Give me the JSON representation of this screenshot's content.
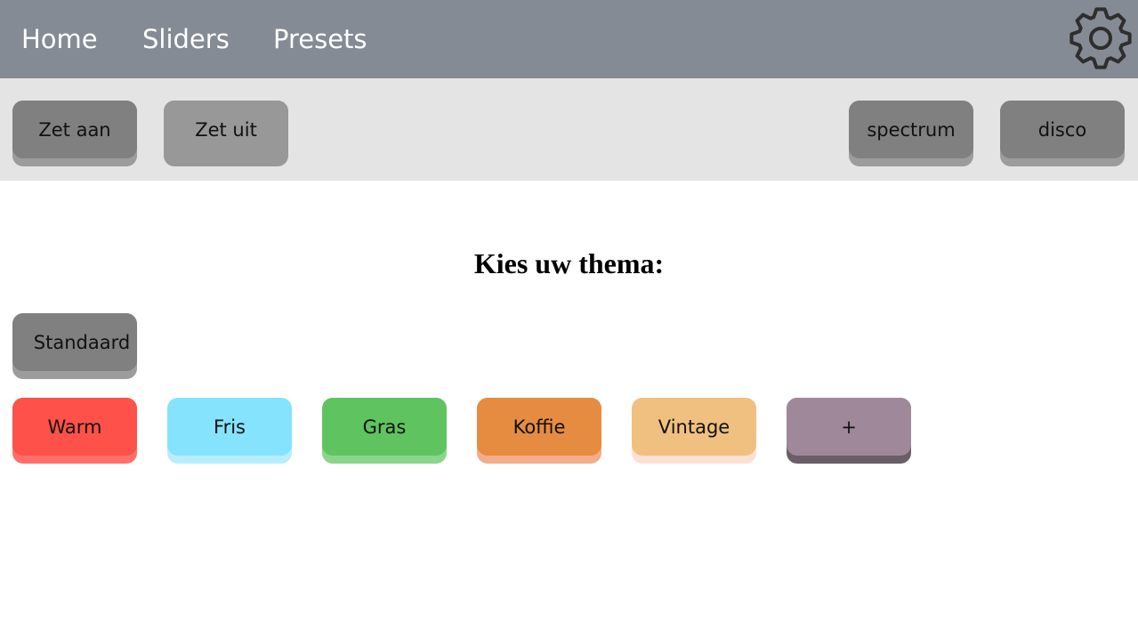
{
  "nav": {
    "links": [
      "Home",
      "Sliders",
      "Presets"
    ]
  },
  "toolbar": {
    "buttons": [
      {
        "label": "Zet aan",
        "face": "#808080",
        "shadow": "#9c9c9c"
      },
      {
        "label": "Zet uit",
        "face": "#989898",
        "shadow": "#989898"
      },
      {
        "label": "spectrum",
        "face": "#808080",
        "shadow": "#9c9c9c"
      },
      {
        "label": "disco",
        "face": "#808080",
        "shadow": "#9c9c9c"
      }
    ]
  },
  "theme": {
    "title": "Kies uw thema:",
    "default_button": {
      "label": "Standaard",
      "face": "#808080",
      "shadow": "#9c9c9c"
    },
    "buttons": [
      {
        "label": "Warm",
        "face": "#fe5149",
        "shadow": "#fd7069"
      },
      {
        "label": "Fris",
        "face": "#85e3fe",
        "shadow": "#b7eefe"
      },
      {
        "label": "Gras",
        "face": "#5fc45f",
        "shadow": "#8ad68a"
      },
      {
        "label": "Koffie",
        "face": "#e68c41",
        "shadow": "#f3ad8a"
      },
      {
        "label": "Vintage",
        "face": "#f0c080",
        "shadow": "#fde0d4"
      },
      {
        "label": "+",
        "face": "#9e8899",
        "shadow": "#6a5e68"
      }
    ]
  },
  "colors": {
    "navbar": "#848b95",
    "toolbar": "#e4e4e4",
    "gear": "#2e2e2e"
  },
  "icons": {
    "settings": "gear-icon"
  }
}
